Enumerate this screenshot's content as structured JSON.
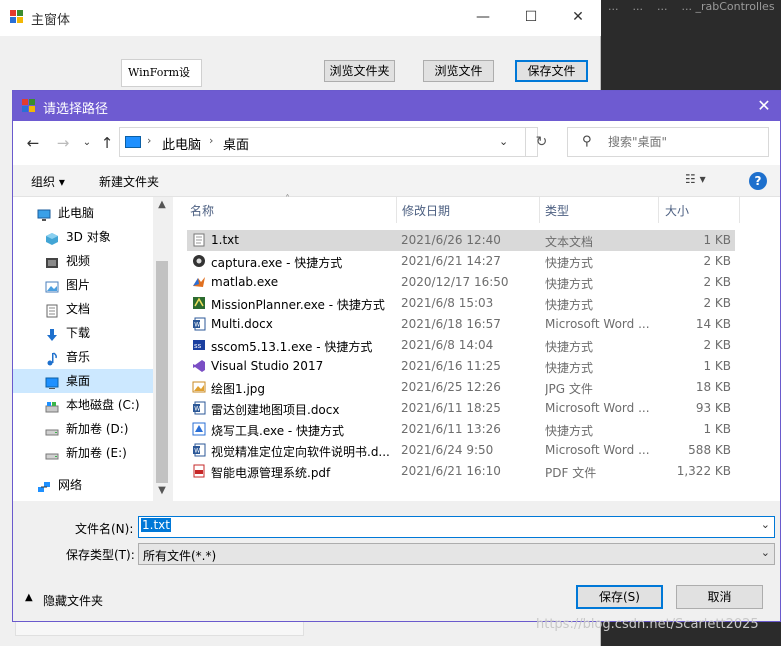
{
  "background": {
    "tabs": [
      "...",
      "...",
      "...",
      "... _rabControlles"
    ]
  },
  "main_window": {
    "title": "主窗体",
    "controls": {
      "min": "—",
      "max": "☐",
      "close": "✕"
    },
    "winform_label": "WinForm设计",
    "buttons": {
      "browse_folder": "浏览文件夹",
      "browse_file": "浏览文件",
      "save_file": "保存文件"
    }
  },
  "dialog": {
    "title": "请选择路径",
    "close": "✕",
    "address": {
      "crumbs": [
        "此电脑",
        "桌面"
      ],
      "sep": "›"
    },
    "search": {
      "placeholder": "搜索\"桌面\""
    },
    "toolbar": {
      "organize": "组织 ▾",
      "new_folder": "新建文件夹",
      "view": "☷ ▾",
      "help": "?"
    },
    "nav": [
      {
        "label": "此电脑",
        "icon": "computer-icon",
        "indent": false,
        "selected": false
      },
      {
        "label": "3D 对象",
        "icon": "cube-3d-icon",
        "indent": true,
        "selected": false
      },
      {
        "label": "视频",
        "icon": "video-icon",
        "indent": true,
        "selected": false
      },
      {
        "label": "图片",
        "icon": "picture-icon",
        "indent": true,
        "selected": false
      },
      {
        "label": "文档",
        "icon": "document-icon",
        "indent": true,
        "selected": false
      },
      {
        "label": "下载",
        "icon": "download-icon",
        "indent": true,
        "selected": false
      },
      {
        "label": "音乐",
        "icon": "music-icon",
        "indent": true,
        "selected": false
      },
      {
        "label": "桌面",
        "icon": "desktop-icon",
        "indent": true,
        "selected": true
      },
      {
        "label": "本地磁盘 (C:)",
        "icon": "local-disk-icon",
        "indent": true,
        "selected": false
      },
      {
        "label": "新加卷 (D:)",
        "icon": "drive-icon",
        "indent": true,
        "selected": false
      },
      {
        "label": "新加卷 (E:)",
        "icon": "drive-icon",
        "indent": true,
        "selected": false
      },
      {
        "label": "网络",
        "icon": "network-icon",
        "indent": false,
        "selected": false
      }
    ],
    "columns": {
      "name": "名称",
      "date": "修改日期",
      "type": "类型",
      "size": "大小"
    },
    "files": [
      {
        "name": "1.txt",
        "date": "2021/6/26 12:40",
        "type": "文本文档",
        "size": "1 KB",
        "icon": "text-file-icon",
        "selected": true
      },
      {
        "name": "captura.exe - 快捷方式",
        "date": "2021/6/21 14:27",
        "type": "快捷方式",
        "size": "2 KB",
        "icon": "captura-shortcut-icon",
        "selected": false
      },
      {
        "name": "matlab.exe",
        "date": "2020/12/17 16:50",
        "type": "快捷方式",
        "size": "2 KB",
        "icon": "matlab-icon",
        "selected": false
      },
      {
        "name": "MissionPlanner.exe - 快捷方式",
        "date": "2021/6/8 15:03",
        "type": "快捷方式",
        "size": "2 KB",
        "icon": "missionplanner-icon",
        "selected": false
      },
      {
        "name": "Multi.docx",
        "date": "2021/6/18 16:57",
        "type": "Microsoft Word ...",
        "size": "14 KB",
        "icon": "word-doc-icon",
        "selected": false
      },
      {
        "name": "sscom5.13.1.exe - 快捷方式",
        "date": "2021/6/8 14:04",
        "type": "快捷方式",
        "size": "2 KB",
        "icon": "sscom-icon",
        "selected": false
      },
      {
        "name": "Visual Studio 2017",
        "date": "2021/6/16 11:25",
        "type": "快捷方式",
        "size": "1 KB",
        "icon": "visual-studio-icon",
        "selected": false
      },
      {
        "name": "绘图1.jpg",
        "date": "2021/6/25 12:26",
        "type": "JPG 文件",
        "size": "18 KB",
        "icon": "jpg-image-icon",
        "selected": false
      },
      {
        "name": "雷达创建地图项目.docx",
        "date": "2021/6/11 18:25",
        "type": "Microsoft Word ...",
        "size": "93 KB",
        "icon": "word-doc-icon",
        "selected": false
      },
      {
        "name": "烧写工具.exe - 快捷方式",
        "date": "2021/6/11 13:26",
        "type": "快捷方式",
        "size": "1 KB",
        "icon": "flash-tool-icon",
        "selected": false
      },
      {
        "name": "视觉精准定位定向软件说明书.d...",
        "date": "2021/6/24 9:50",
        "type": "Microsoft Word ...",
        "size": "588 KB",
        "icon": "word-doc-icon",
        "selected": false
      },
      {
        "name": "智能电源管理系统.pdf",
        "date": "2021/6/21 16:10",
        "type": "PDF 文件",
        "size": "1,322 KB",
        "icon": "pdf-file-icon",
        "selected": false
      }
    ],
    "filename": {
      "label": "文件名(N):",
      "value": "1.txt"
    },
    "filetype": {
      "label": "保存类型(T):",
      "value": "所有文件(*.*)"
    },
    "hide_folders": "隐藏文件夹",
    "buttons": {
      "save": "保存(S)",
      "cancel": "取消"
    }
  },
  "watermark": "https://blog.csdn.net/Scarlett2025",
  "colors": {
    "accent": "#0078d7",
    "dialog_title": "#6e5bd1",
    "selection": "#cce8ff"
  }
}
